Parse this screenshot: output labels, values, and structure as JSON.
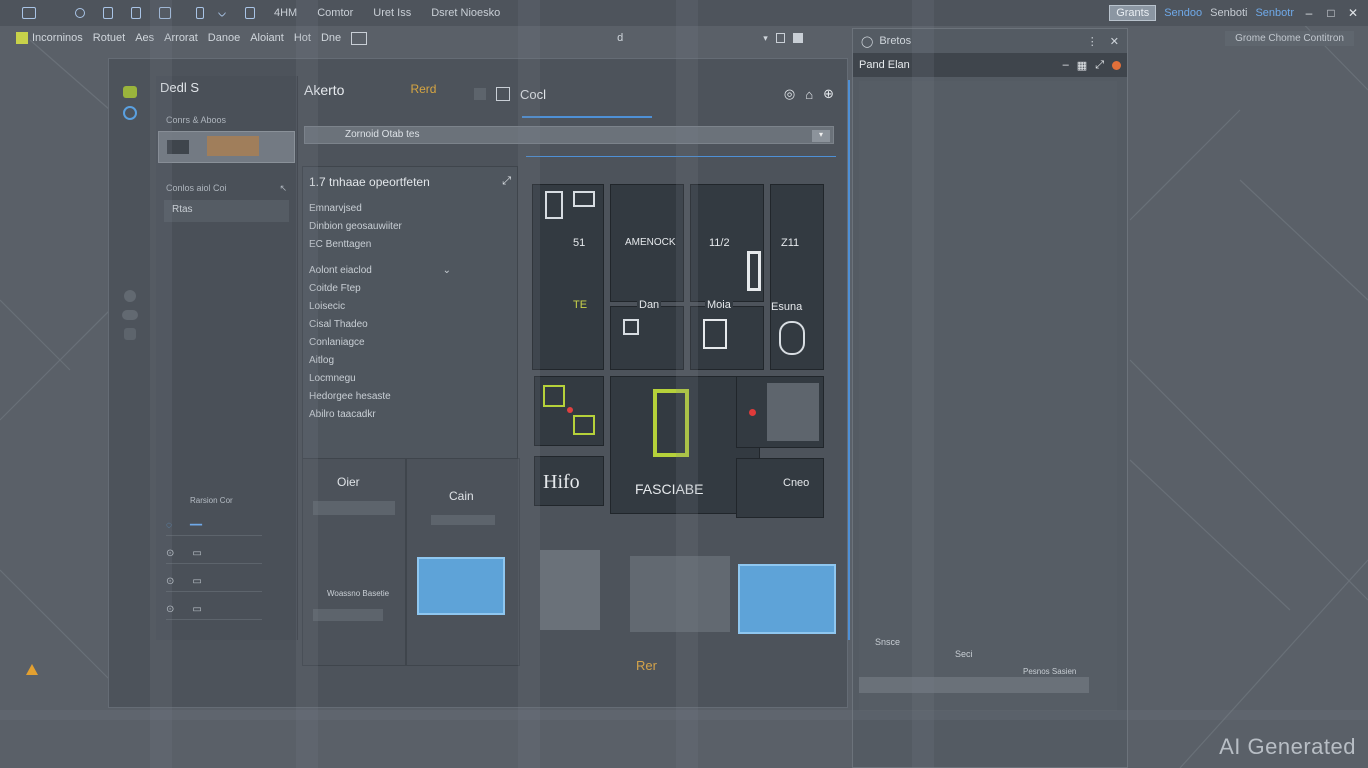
{
  "topbar": {
    "title_left": "4HM",
    "menu": [
      "Comtor",
      "Uret Iss",
      "Dsret Nioesko"
    ],
    "badge": "Grants",
    "right_text": "Senboti",
    "right_link": "Senbotr",
    "link_pre": "Sendoo"
  },
  "menubar": {
    "items": [
      "Incorninos",
      "Rotuet",
      "Aes",
      "Arrorat",
      "Danoe",
      "Aloiant",
      "Hot",
      "Dne"
    ],
    "center": "d",
    "context": "Grome Chome Contitron"
  },
  "panel_a": {
    "title": "Dedl S",
    "section1": "Conrs & Aboos",
    "section2": "Conlos aiol Coi",
    "row1": "Rtas",
    "foot_title": "Rarsion Cor"
  },
  "col2": {
    "title": "Akerto",
    "title_accent": "Rerd",
    "list_header": "1.7 tnhaae opeortfeten",
    "items": [
      "Emnarvjsed",
      "Dinbion geosauwiiter",
      "EC Benttagen",
      "Aolont eiaclod",
      "Coitde Ftep",
      "Loisecic",
      "Cisal Thadeo",
      "Conlaniagce",
      "Aitlog",
      "Locmnegu",
      "Hedorgee hesaste",
      "Abilro taacadkr"
    ],
    "card1_title": "Oier",
    "card2_title": "Cain",
    "card1_caption": "Woassno Basetie"
  },
  "search": {
    "value": "Zornoid Otab tes"
  },
  "col3": {
    "title": "Cocl",
    "tiles": {
      "t1": "51",
      "t2": "AMENOCK",
      "t3": "11/2",
      "t4": "Z11",
      "t5": "TE",
      "t6": "Dan",
      "t7": "Moia",
      "t8": "Esuna",
      "big": "FASCIABE",
      "hifo": "Hifo",
      "cred": "Cneo"
    },
    "bottom_label": "Rer"
  },
  "right_panel": {
    "header": "Bretos",
    "subheader": "Pand Elan",
    "foot1": "Snsce",
    "foot2": "Seci",
    "foot3": "Pesnos Sasien"
  },
  "watermark": "AI Generated",
  "colors": {
    "accent_blue": "#4e90d6",
    "accent_green": "#b6d13a",
    "accent_orange": "#e2703a"
  }
}
